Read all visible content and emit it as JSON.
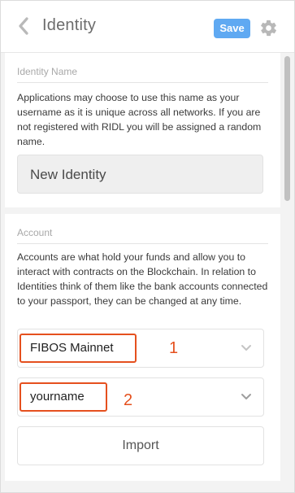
{
  "header": {
    "title": "Identity",
    "save_label": "Save",
    "back_icon": "chevron-left-icon",
    "settings_icon": "gear-icon"
  },
  "identity_name": {
    "label": "Identity Name",
    "description": "Applications may choose to use this name as your username as it is unique across all networks. If you are not registered with RIDL you will be assigned a random name.",
    "value": "New Identity"
  },
  "account": {
    "label": "Account",
    "description": "Accounts are what hold your funds and allow you to interact with contracts on the Blockchain. In relation to Identities think of them like the bank accounts connected to your passport, they can be changed at any time.",
    "network_select": {
      "value": "FIBOS Mainnet",
      "annotation": "1"
    },
    "account_select": {
      "value": "yourname",
      "annotation": "2"
    },
    "import_label": "Import"
  },
  "colors": {
    "accent": "#5fa9f2",
    "annotation": "#e5501e",
    "background": "#f3f3f3"
  }
}
